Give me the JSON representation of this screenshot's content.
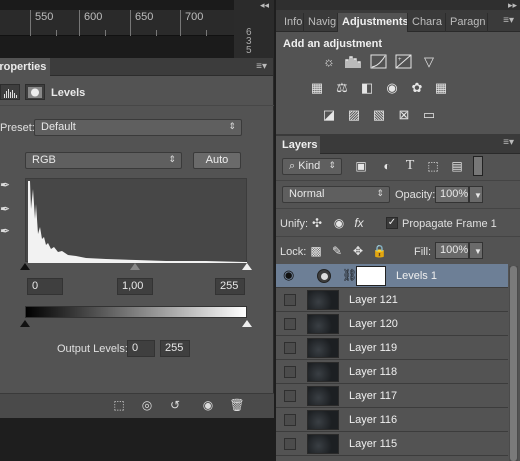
{
  "ruler": {
    "labels": [
      "550",
      "600",
      "650",
      "700"
    ]
  },
  "vertical_ruler": {
    "label": "635"
  },
  "properties": {
    "tab_label": "Properties",
    "title": "Levels",
    "preset_label": "Preset:",
    "preset_value": "Default",
    "channel_value": "RGB",
    "auto_label": "Auto",
    "input_black": "0",
    "input_gamma": "1,00",
    "input_white": "255",
    "output_label": "Output Levels:",
    "output_black": "0",
    "output_white": "255"
  },
  "adjustments": {
    "tabs": [
      "Info",
      "Navig",
      "Adjustments",
      "Chara",
      "Paragn"
    ],
    "title": "Add an adjustment"
  },
  "layers": {
    "tab_label": "Layers",
    "filter_kind": "Kind",
    "blend_mode": "Normal",
    "opacity_label": "Opacity:",
    "opacity_value": "100%",
    "unify_label": "Unify:",
    "propagate_label": "Propagate Frame 1",
    "lock_label": "Lock:",
    "fill_label": "Fill:",
    "fill_value": "100%",
    "items": [
      "Levels 1",
      "Layer 121",
      "Layer 120",
      "Layer 119",
      "Layer 118",
      "Layer 117",
      "Layer 116",
      "Layer 115"
    ]
  }
}
